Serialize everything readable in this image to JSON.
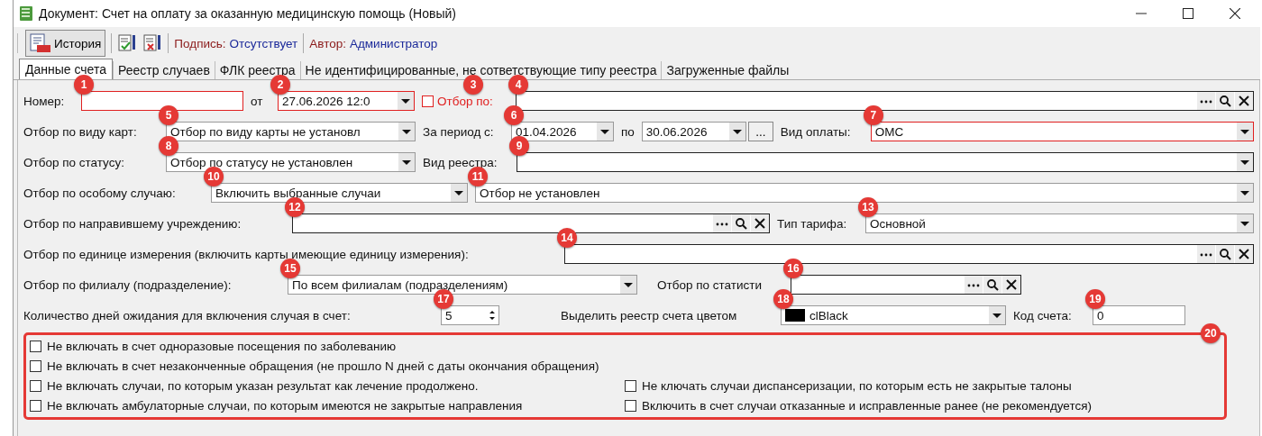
{
  "window": {
    "title": "Документ: Счет на оплату за оказанную медицинскую помощь (Новый)"
  },
  "toolbar": {
    "history": "История",
    "signature_label": "Подпись:",
    "signature_value": "Отсутствует",
    "author_label": "Автор:",
    "author_value": "Администратор"
  },
  "tabs": [
    {
      "label": "Данные счета",
      "selected": true
    },
    {
      "label": "Реестр случаев",
      "selected": false
    },
    {
      "label": "ФЛК реестра",
      "selected": false
    },
    {
      "label": "Не идентифицированные, не сответствующие типу реестра",
      "selected": false
    },
    {
      "label": "Загруженные файлы",
      "selected": false
    }
  ],
  "form": {
    "number": {
      "label": "Номер:",
      "required": true,
      "badge": "1"
    },
    "date": {
      "label": "от",
      "value": "27.06.2026 12:0",
      "required": true,
      "badge": "2"
    },
    "filter_by": {
      "label": "Отбор по:",
      "checked": false,
      "highlighted": true,
      "badge": "3"
    },
    "filter_lookup": {
      "badge": "4"
    },
    "card_type": {
      "label": "Отбор по виду карт:",
      "value": "Отбор по виду карты не установл",
      "badge": "5"
    },
    "period": {
      "label": "За период с:",
      "from": "01.04.2026",
      "to_label": "по",
      "to": "30.06.2026",
      "button": "...",
      "badge": "6"
    },
    "payment": {
      "label": "Вид оплаты:",
      "value": "ОМС",
      "required": true,
      "badge": "7"
    },
    "status": {
      "label": "Отбор по статусу:",
      "value": "Отбор по статусу не установлен",
      "badge": "8"
    },
    "registry": {
      "label": "Вид реестра:",
      "badge": "9"
    },
    "special": {
      "label": "Отбор по особому случаю:",
      "mode": "Включить выбранные случаи",
      "mode_badge": "10",
      "value": "Отбор не установлен",
      "badge": "11"
    },
    "referrer": {
      "label": "Отбор по направившему учреждению:",
      "badge": "12"
    },
    "tariff": {
      "label": "Тип тарифа:",
      "value": "Основной",
      "badge": "13"
    },
    "unit": {
      "label": "Отбор по единице измерения (включить карты имеющие единицу измерения):",
      "badge": "14"
    },
    "branch": {
      "label": "Отбор по филиалу (подразделение):",
      "value": "По всем филиалам (подразделениям)",
      "badge": "15"
    },
    "statistics": {
      "label": "Отбор по статисти",
      "badge": "16"
    },
    "wait_days": {
      "label": "Количество дней ожидания для включения случая в счет:",
      "value": "5",
      "badge": "17"
    },
    "color": {
      "label": "Выделить реестр счета цветом",
      "value": "clBlack",
      "color": "#000000",
      "badge": "18"
    },
    "code": {
      "label": "Код счета:",
      "value": "0",
      "badge": "19"
    }
  },
  "options": {
    "badge": "20",
    "rows": [
      [
        {
          "label": "Не включать в счет одноразовые посещения по заболеванию",
          "checked": false
        }
      ],
      [
        {
          "label": "Не включать в счет незаконченные обращения (не прошло N дней с даты окончания обращения)",
          "checked": false
        }
      ],
      [
        {
          "label": "Не включать случаи, по которым указан результат как лечение продолжено.",
          "checked": false
        },
        {
          "label": "Не ключать случаи диспансеризации, по которым есть не закрытые талоны",
          "checked": false
        }
      ],
      [
        {
          "label": "Не включать амбулаторные случаи, по которым имеются не закрытые направления",
          "checked": false
        },
        {
          "label": "Включить в счет случаи отказанные и исправленные ранее (не рекомендуется)",
          "checked": false
        }
      ]
    ]
  }
}
